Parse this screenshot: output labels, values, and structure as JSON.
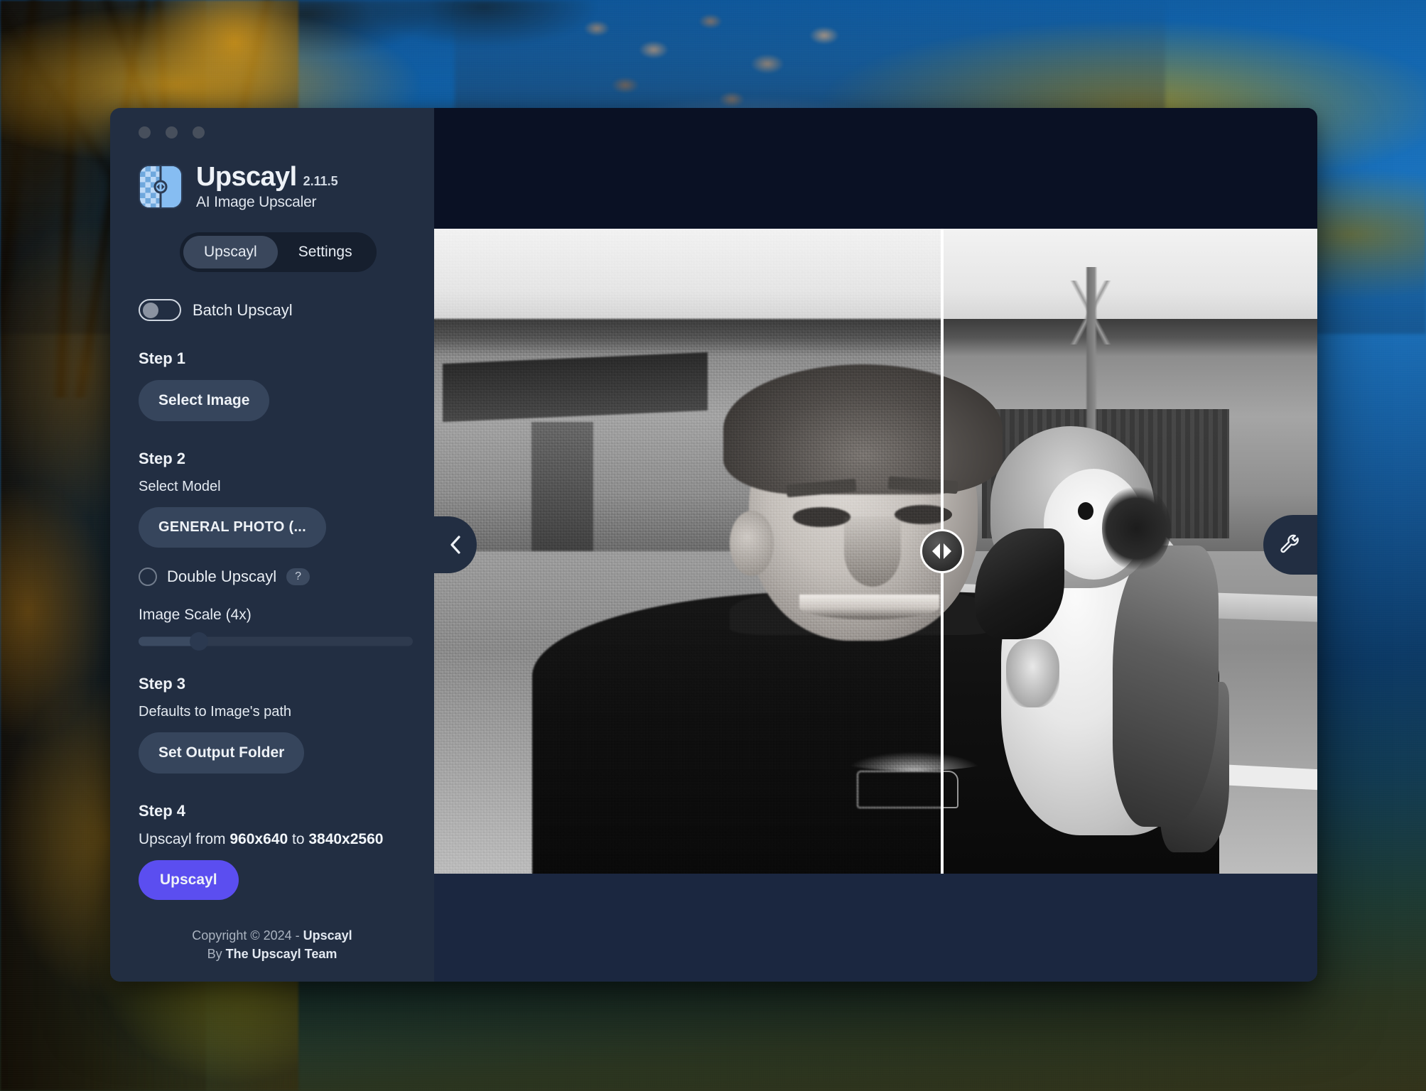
{
  "window": {
    "traffic_lights": [
      "close",
      "minimize",
      "maximize"
    ]
  },
  "brand": {
    "name": "Upscayl",
    "version": "2.11.5",
    "subtitle": "AI Image Upscaler",
    "logo_icon": "upscayl-compare-logo-icon"
  },
  "tabs": [
    {
      "label": "Upscayl",
      "active": true
    },
    {
      "label": "Settings",
      "active": false
    }
  ],
  "batch": {
    "label": "Batch Upscayl",
    "enabled": false
  },
  "steps": {
    "step1": {
      "title": "Step 1",
      "select_image_label": "Select Image"
    },
    "step2": {
      "title": "Step 2",
      "select_model_label": "Select Model",
      "model_value": "GENERAL PHOTO (...",
      "double_upscayl_label": "Double Upscayl",
      "double_upscayl_checked": false,
      "help_badge": "?",
      "image_scale_label": "Image Scale (4x)",
      "scale_percent": 22
    },
    "step3": {
      "title": "Step 3",
      "subtitle": "Defaults to Image's path",
      "set_output_folder_label": "Set Output Folder"
    },
    "step4": {
      "title": "Step 4",
      "summary_prefix": "Upscayl from",
      "source_size": "960x640",
      "summary_middle": "to",
      "target_size": "3840x2560",
      "upscayl_button_label": "Upscayl"
    }
  },
  "footer": {
    "copyright": "Copyright © 2024 - ",
    "copyright_brand": "Upscayl",
    "by_prefix": "By ",
    "by_team": "The Upscayl Team"
  },
  "viewer": {
    "prev_icon": "chevron-left-icon",
    "tools_icon": "wrench-icon",
    "compare_handle_icon": "left-right-arrows-icon",
    "divider_position_percent": 57.5,
    "photo_description": "Black and white photo of a smiling man with a macaw parrot perched on his shoulder on a city street"
  },
  "colors": {
    "accent": "#5b4ef0",
    "sidebar_bg": "#222e42",
    "panel_bg": "#1b2740",
    "letterbox": "#0a1124",
    "logo_blue": "#86bdf2",
    "divider": "#ffffff"
  }
}
